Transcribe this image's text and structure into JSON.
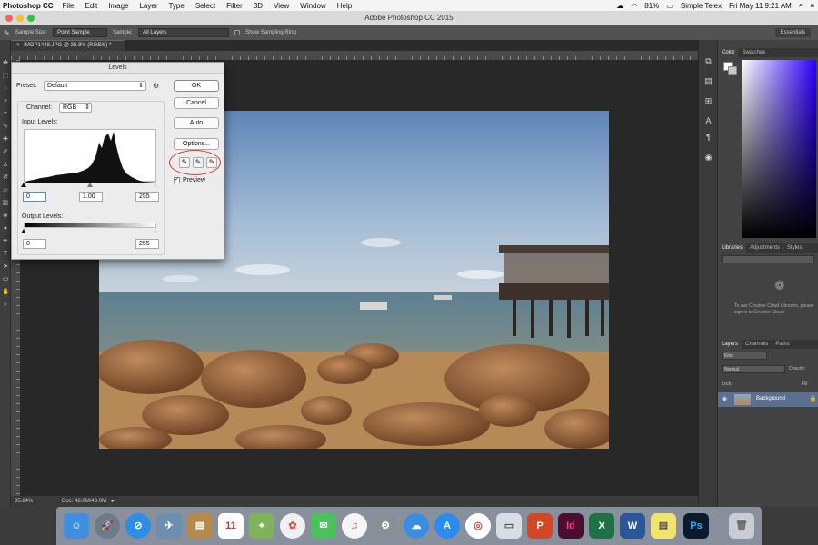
{
  "menubar": {
    "app": "Photoshop CC",
    "items": [
      "File",
      "Edit",
      "Image",
      "Layer",
      "Type",
      "Select",
      "Filter",
      "3D",
      "View",
      "Window",
      "Help"
    ],
    "battery": "81%",
    "user": "Simple Telex",
    "clock": "Fri May 11  9:21 AM"
  },
  "titlebar": {
    "title": "Adobe Photoshop CC 2015"
  },
  "options": {
    "sample_size_label": "Sample Size:",
    "sample_size_value": "Point Sample",
    "sample_label": "Sample:",
    "sample_value": "All Layers",
    "show_ring_label": "Show Sampling Ring",
    "workspace": "Essentials"
  },
  "document": {
    "tab": "IMGP1448.JPG @ 35.8% (RGB/8) *",
    "zoom": "35.84%",
    "doc_info": "Doc: 48.0M/48.0M"
  },
  "levels": {
    "title": "Levels",
    "preset_label": "Preset:",
    "preset_value": "Default",
    "channel_label": "Channel:",
    "channel_value": "RGB",
    "input_levels_label": "Input Levels:",
    "input_black": "0",
    "input_gamma": "1.00",
    "input_white": "255",
    "output_levels_label": "Output Levels:",
    "output_black": "0",
    "output_white": "255",
    "ok": "OK",
    "cancel": "Cancel",
    "auto": "Auto",
    "options": "Options...",
    "preview": "Preview"
  },
  "panels": {
    "color_tabs": [
      "Color",
      "Swatches"
    ],
    "lib_tabs": [
      "Libraries",
      "Adjustments",
      "Styles"
    ],
    "lib_message": "To use Creative Cloud Libraries, please sign in to Creative Cloud",
    "layer_tabs": [
      "Layers",
      "Channels",
      "Paths"
    ],
    "kind": "Kind",
    "blend_mode": "Normal",
    "opacity_label": "Opacity:",
    "lock_label": "Lock:",
    "fill_label": "Fill:",
    "layer_name": "Background"
  },
  "dock": {
    "calendar_day": "11",
    "apps": [
      "Finder",
      "Launchpad",
      "Safari",
      "Preview",
      "Notes",
      "Calendar",
      "Maps",
      "Photos",
      "Messages",
      "iTunes",
      "System Preferences",
      "Feedback",
      "App Store",
      "Chrome",
      "Preview",
      "PowerPoint",
      "InDesign",
      "Excel",
      "Word",
      "Stickies",
      "Photoshop",
      "Trash"
    ],
    "labels": {
      "indesign": "Id",
      "excel": "X",
      "word": "W",
      "powerpoint": "P",
      "photoshop": "Ps"
    }
  }
}
